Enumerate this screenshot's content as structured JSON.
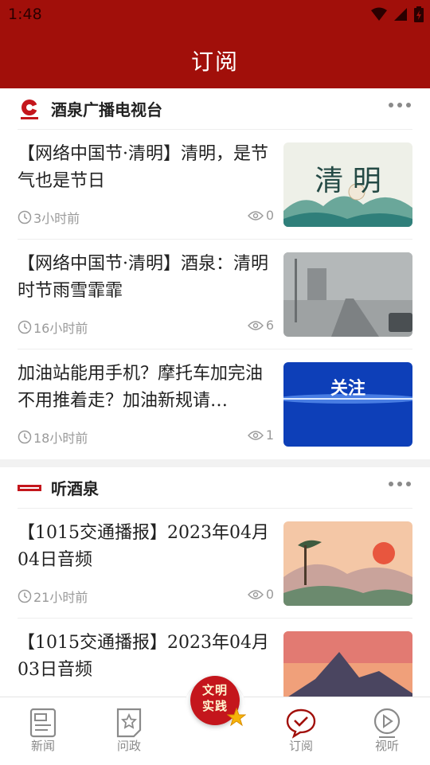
{
  "status_bar": {
    "time": "1:48"
  },
  "header": {
    "title": "订阅"
  },
  "sections": [
    {
      "name": "酒泉广播电视台",
      "articles": [
        {
          "title": "【网络中国节·清明】清明，是节气也是节日",
          "time": "3小时前",
          "views": "0",
          "thumb_text": "清 明",
          "thumb_subtext": ""
        },
        {
          "title": "【网络中国节·清明】酒泉：清明时节雨雪霏霏",
          "time": "16小时前",
          "views": "6",
          "thumb_text": "",
          "thumb_subtext": ""
        },
        {
          "title": "加油站能用手机？摩托车加完油不用推着走？加油新规请…",
          "time": "18小时前",
          "views": "1",
          "thumb_text": "关注",
          "thumb_subtext": ""
        }
      ]
    },
    {
      "name": "听酒泉",
      "articles": [
        {
          "title": "【1015交通播报】2023年04月04日音频",
          "time": "21小时前",
          "views": "0",
          "thumb_text": "",
          "thumb_subtext": ""
        },
        {
          "title": "【1015交通播报】2023年04月03日音频",
          "time": "",
          "views": "",
          "thumb_text": "",
          "thumb_subtext": ""
        }
      ]
    }
  ],
  "tabs": [
    {
      "label": "新闻",
      "icon": "news-icon"
    },
    {
      "label": "问政",
      "icon": "inquiry-icon"
    },
    {
      "label": "",
      "icon": "civilization-practice-icon"
    },
    {
      "label": "订阅",
      "icon": "subscribe-icon"
    },
    {
      "label": "视听",
      "icon": "play-icon"
    }
  ],
  "center_button": {
    "line1": "文明",
    "line2": "实践"
  },
  "colors": {
    "brand": "#a10f0a",
    "text": "#222222",
    "meta": "#9a9a9a",
    "active_tab": "#a10f0a"
  }
}
